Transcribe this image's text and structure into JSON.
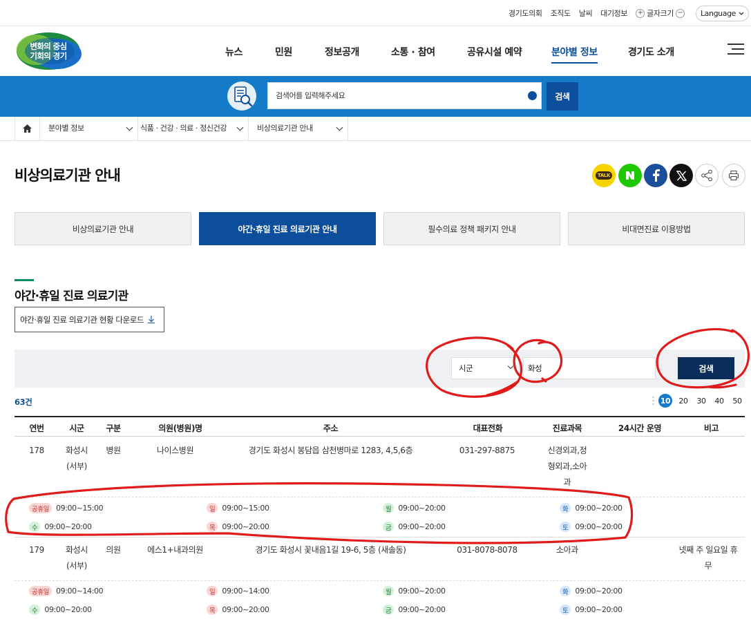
{
  "util": {
    "links": [
      "경기도의회",
      "조직도",
      "날씨",
      "대기정보"
    ],
    "fontsize_label": "글자크기",
    "plus": "+",
    "minus": "−",
    "language": "Language"
  },
  "logo": {
    "line1": "변화의 중심",
    "line2": "기회의 경기"
  },
  "gnb": [
    "뉴스",
    "민원",
    "정보공개",
    "소통 · 참여",
    "공유시설 예약",
    "분야별 정보",
    "경기도 소개"
  ],
  "gnb_active": "분야별 정보",
  "search": {
    "placeholder": "검색어를 입력해주세요",
    "button": "검색"
  },
  "breadcrumb": [
    "분야별 정보",
    "식품 · 건강 · 의료 · 정신건강",
    "비상의료기관 안내"
  ],
  "page_title": "비상의료기관 안내",
  "share_icons": [
    "kakaotalk-icon",
    "naver-icon",
    "facebook-icon",
    "x-icon",
    "share-icon",
    "print-icon"
  ],
  "kakao_label": "TALK",
  "tabs": [
    "비상의료기관 안내",
    "야간·휴일 진료 의료기관 안내",
    "필수의료 정책 패키지 안내",
    "비대면진료 이용방법"
  ],
  "tab_active_index": 1,
  "section_title": "야간·휴일 진료 의료기관",
  "download_label": "야간·휴일 진료 의료기관 현황 다운로드",
  "filter": {
    "select_value": "시군",
    "input_value": "화성",
    "button": "검색"
  },
  "count": "63건",
  "page_sizes": [
    "10",
    "20",
    "30",
    "40",
    "50"
  ],
  "page_size_active": "10",
  "table": {
    "headers": [
      "연번",
      "시군",
      "구분",
      "의원(병원)명",
      "주소",
      "대표전화",
      "진료과목",
      "24시간 운영",
      "비고"
    ],
    "rows": [
      {
        "no": "178",
        "city1": "화성시",
        "city2": "(서부)",
        "type": "병원",
        "name": "나이스병원",
        "address": "경기도 화성시 봉담읍 삼천병마로 1283, 4,5,6층",
        "phone": "031-297-8875",
        "dept1": "신경외과,정",
        "dept2": "형외과,소아",
        "dept3": "과",
        "h24": "",
        "note1": "",
        "note2": "",
        "hours": [
          {
            "day": "공휴일",
            "time": "09:00~15:00",
            "color": "red"
          },
          {
            "day": "일",
            "time": "09:00~15:00",
            "color": "red"
          },
          {
            "day": "월",
            "time": "09:00~20:00",
            "color": "grn"
          },
          {
            "day": "화",
            "time": "09:00~20:00",
            "color": "blu"
          },
          {
            "day": "수",
            "time": "09:00~20:00",
            "color": "grn"
          },
          {
            "day": "목",
            "time": "09:00~20:00",
            "color": "red"
          },
          {
            "day": "금",
            "time": "09:00~20:00",
            "color": "grn"
          },
          {
            "day": "토",
            "time": "09:00~20:00",
            "color": "blu"
          }
        ]
      },
      {
        "no": "179",
        "city1": "화성시",
        "city2": "(서부)",
        "type": "의원",
        "name": "에스1+내과의원",
        "address": "경기도 화성시 꽃내음1길 19-6, 5층 (새솔동)",
        "phone": "031-8078-8078",
        "dept1": "소아과",
        "dept2": "",
        "dept3": "",
        "h24": "",
        "note1": "넷째 주 일요일 휴",
        "note2": "무",
        "hours": [
          {
            "day": "공휴일",
            "time": "09:00~14:00",
            "color": "red"
          },
          {
            "day": "일",
            "time": "09:00~14:00",
            "color": "red"
          },
          {
            "day": "월",
            "time": "09:00~20:00",
            "color": "grn"
          },
          {
            "day": "화",
            "time": "09:00~20:00",
            "color": "blu"
          },
          {
            "day": "수",
            "time": "09:00~20:00",
            "color": "grn"
          },
          {
            "day": "목",
            "time": "09:00~20:00",
            "color": "red"
          },
          {
            "day": "금",
            "time": "09:00~20:00",
            "color": "grn"
          },
          {
            "day": "토",
            "time": "09:00~20:00",
            "color": "blu"
          }
        ]
      }
    ]
  },
  "colors": {
    "primary": "#0d4e9c",
    "band": "#137bc7",
    "annotation": "#e01b1b"
  }
}
